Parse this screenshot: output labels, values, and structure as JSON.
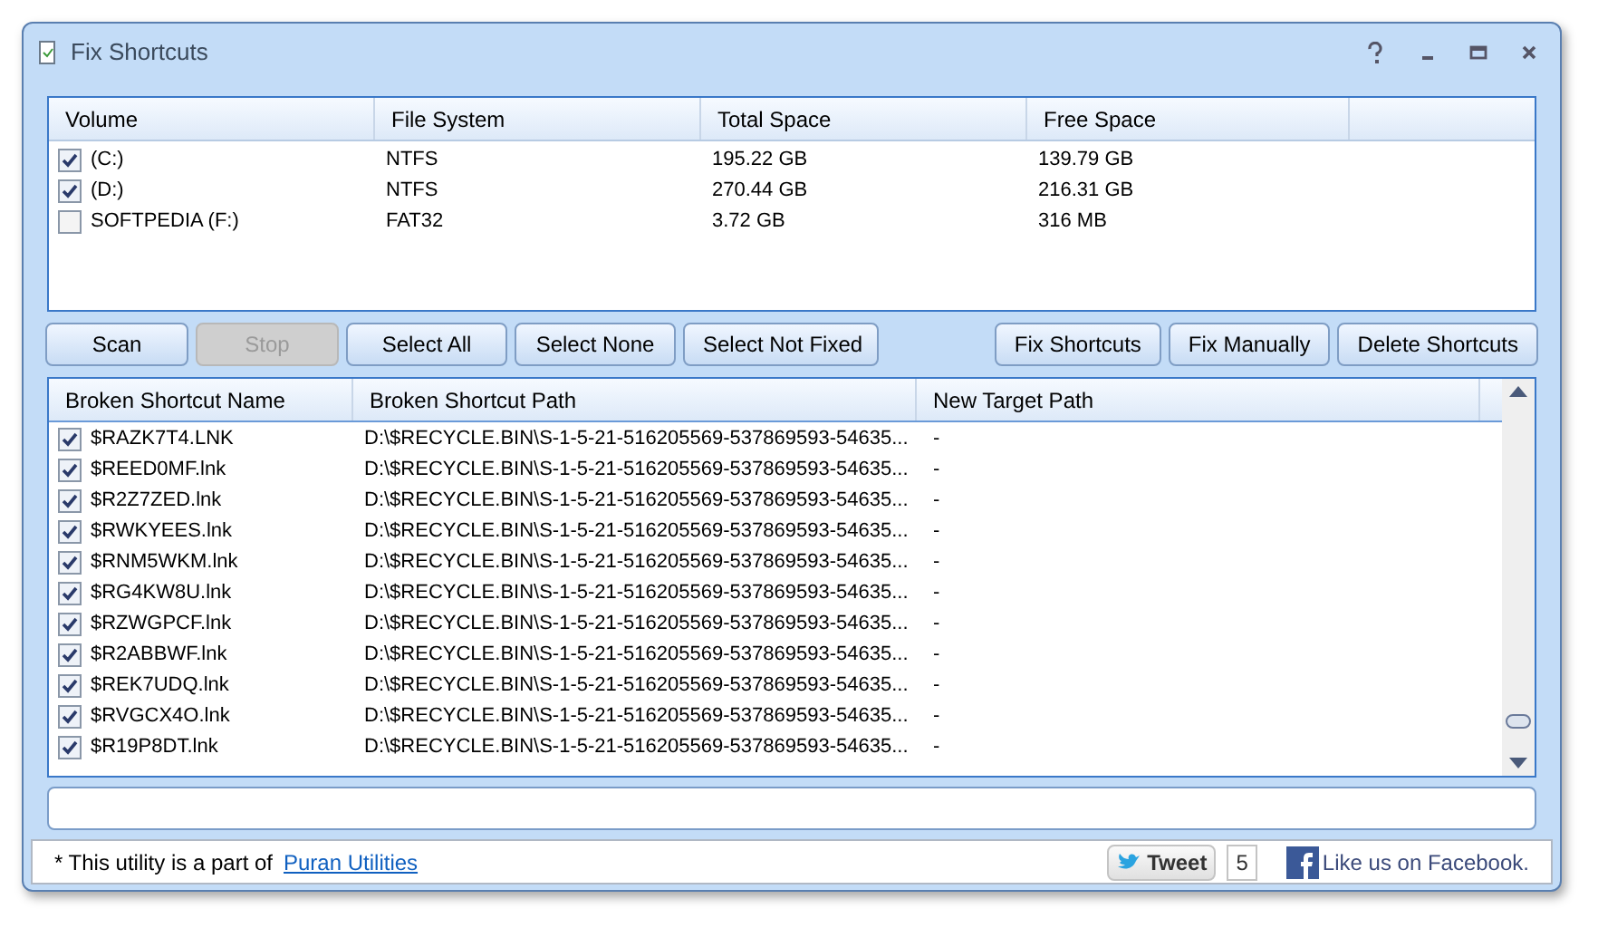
{
  "window": {
    "title": "Fix Shortcuts"
  },
  "volumes": {
    "columns": [
      "Volume",
      "File System",
      "Total Space",
      "Free Space"
    ],
    "rows": [
      {
        "name": "(C:)",
        "checked": true,
        "file_system": "NTFS",
        "total": "195.22 GB",
        "free": "139.79 GB"
      },
      {
        "name": "(D:)",
        "checked": true,
        "file_system": "NTFS",
        "total": "270.44 GB",
        "free": "216.31 GB"
      },
      {
        "name": "SOFTPEDIA (F:)",
        "checked": false,
        "file_system": "FAT32",
        "total": "3.72 GB",
        "free": "316 MB"
      }
    ]
  },
  "buttons_left": [
    {
      "label": "Scan",
      "disabled": false
    },
    {
      "label": "Stop",
      "disabled": true
    },
    {
      "label": "Select All",
      "disabled": false
    },
    {
      "label": "Select None",
      "disabled": false
    },
    {
      "label": "Select Not Fixed",
      "disabled": false
    }
  ],
  "buttons_right": [
    {
      "label": "Fix Shortcuts",
      "disabled": false
    },
    {
      "label": "Fix Manually",
      "disabled": false
    },
    {
      "label": "Delete Shortcuts",
      "disabled": false
    }
  ],
  "shortcuts": {
    "columns": [
      "Broken Shortcut Name",
      "Broken Shortcut Path",
      "New Target Path"
    ],
    "rows": [
      {
        "name": "$RAZK7T4.LNK",
        "checked": true,
        "path": "D:\\$RECYCLE.BIN\\S-1-5-21-516205569-537869593-54635...",
        "target": "-"
      },
      {
        "name": "$REED0MF.lnk",
        "checked": true,
        "path": "D:\\$RECYCLE.BIN\\S-1-5-21-516205569-537869593-54635...",
        "target": "-"
      },
      {
        "name": "$R2Z7ZED.lnk",
        "checked": true,
        "path": "D:\\$RECYCLE.BIN\\S-1-5-21-516205569-537869593-54635...",
        "target": "-"
      },
      {
        "name": "$RWKYEES.lnk",
        "checked": true,
        "path": "D:\\$RECYCLE.BIN\\S-1-5-21-516205569-537869593-54635...",
        "target": "-"
      },
      {
        "name": "$RNM5WKM.lnk",
        "checked": true,
        "path": "D:\\$RECYCLE.BIN\\S-1-5-21-516205569-537869593-54635...",
        "target": "-"
      },
      {
        "name": "$RG4KW8U.lnk",
        "checked": true,
        "path": "D:\\$RECYCLE.BIN\\S-1-5-21-516205569-537869593-54635...",
        "target": "-"
      },
      {
        "name": "$RZWGPCF.lnk",
        "checked": true,
        "path": "D:\\$RECYCLE.BIN\\S-1-5-21-516205569-537869593-54635...",
        "target": "-"
      },
      {
        "name": "$R2ABBWF.lnk",
        "checked": true,
        "path": "D:\\$RECYCLE.BIN\\S-1-5-21-516205569-537869593-54635...",
        "target": "-"
      },
      {
        "name": "$REK7UDQ.lnk",
        "checked": true,
        "path": "D:\\$RECYCLE.BIN\\S-1-5-21-516205569-537869593-54635...",
        "target": "-"
      },
      {
        "name": "$RVGCX4O.lnk",
        "checked": true,
        "path": "D:\\$RECYCLE.BIN\\S-1-5-21-516205569-537869593-54635...",
        "target": "-"
      },
      {
        "name": "$R19P8DT.lnk",
        "checked": true,
        "path": "D:\\$RECYCLE.BIN\\S-1-5-21-516205569-537869593-54635...",
        "target": "-"
      }
    ]
  },
  "footer": {
    "note": "* This utility is a part of",
    "link": "Puran Utilities",
    "tweet": "Tweet",
    "tweet_count": "5",
    "facebook": "Like us on Facebook."
  }
}
